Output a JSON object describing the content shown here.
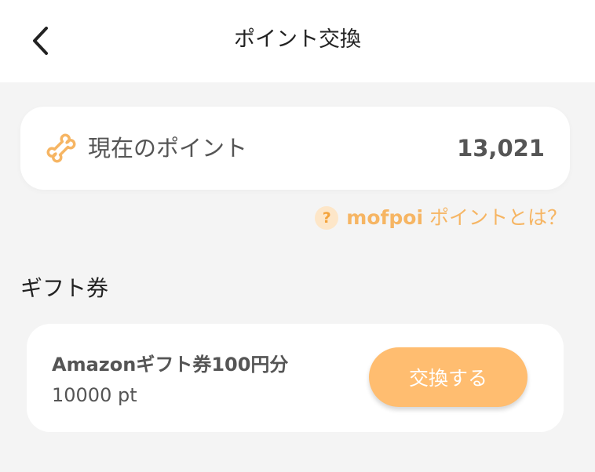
{
  "header": {
    "title": "ポイント交換",
    "back_icon": "chevron-left-icon"
  },
  "points_card": {
    "icon": "bone-icon",
    "label": "現在のポイント",
    "value": "13,021"
  },
  "help_link": {
    "icon": "question-icon",
    "icon_glyph": "?",
    "brand": "mofpoi",
    "text": " ポイントとは？"
  },
  "section": {
    "title": "ギフト券"
  },
  "gift_items": [
    {
      "name": "Amazonギフト券100円分",
      "cost": "10000 pt",
      "button_label": "交換する"
    }
  ],
  "colors": {
    "accent": "#ffbd70",
    "accent_text": "#f6b563",
    "background": "#f4f4f4",
    "card": "#ffffff"
  }
}
